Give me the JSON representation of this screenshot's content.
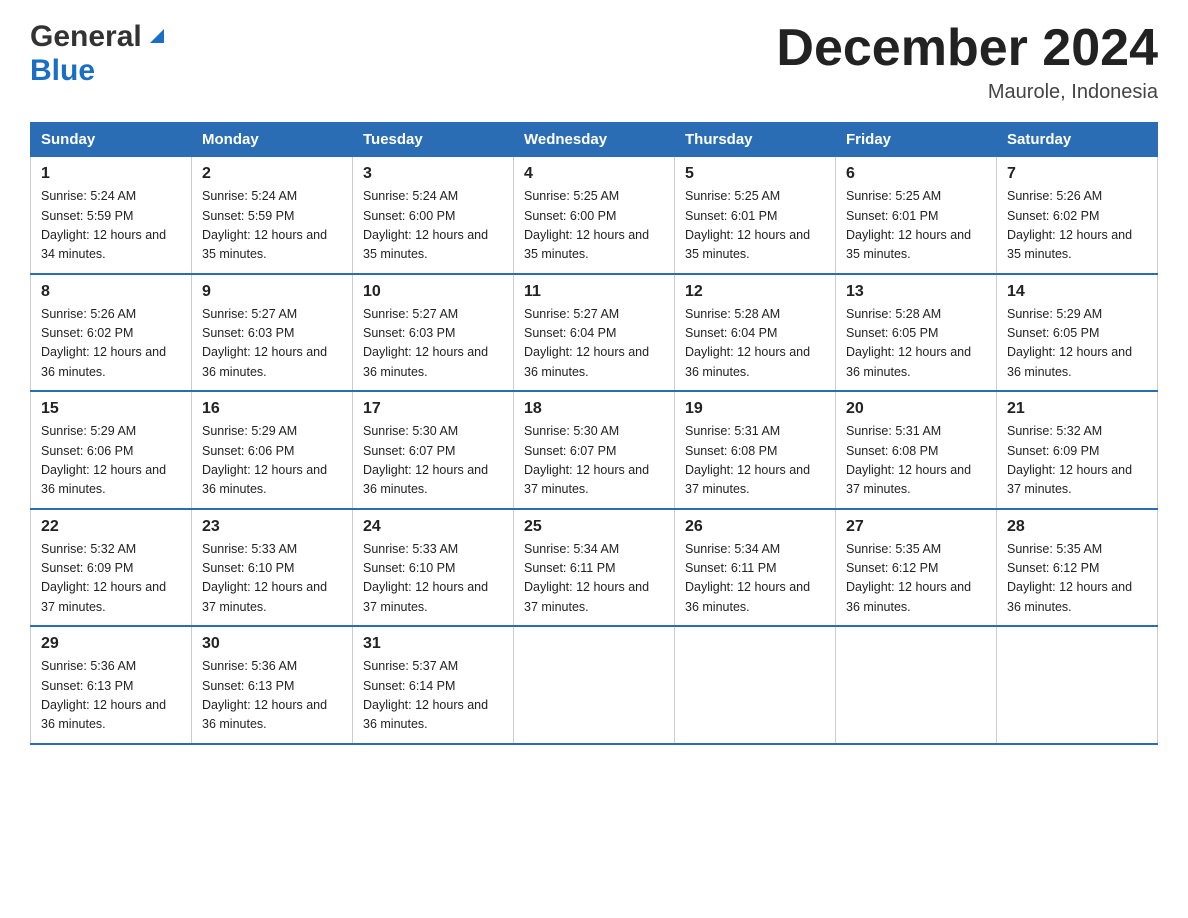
{
  "header": {
    "logo_general": "General",
    "logo_blue": "Blue",
    "month_title": "December 2024",
    "location": "Maurole, Indonesia"
  },
  "days_of_week": [
    "Sunday",
    "Monday",
    "Tuesday",
    "Wednesday",
    "Thursday",
    "Friday",
    "Saturday"
  ],
  "weeks": [
    [
      {
        "day": "1",
        "sunrise": "5:24 AM",
        "sunset": "5:59 PM",
        "daylight": "12 hours and 34 minutes."
      },
      {
        "day": "2",
        "sunrise": "5:24 AM",
        "sunset": "5:59 PM",
        "daylight": "12 hours and 35 minutes."
      },
      {
        "day": "3",
        "sunrise": "5:24 AM",
        "sunset": "6:00 PM",
        "daylight": "12 hours and 35 minutes."
      },
      {
        "day": "4",
        "sunrise": "5:25 AM",
        "sunset": "6:00 PM",
        "daylight": "12 hours and 35 minutes."
      },
      {
        "day": "5",
        "sunrise": "5:25 AM",
        "sunset": "6:01 PM",
        "daylight": "12 hours and 35 minutes."
      },
      {
        "day": "6",
        "sunrise": "5:25 AM",
        "sunset": "6:01 PM",
        "daylight": "12 hours and 35 minutes."
      },
      {
        "day": "7",
        "sunrise": "5:26 AM",
        "sunset": "6:02 PM",
        "daylight": "12 hours and 35 minutes."
      }
    ],
    [
      {
        "day": "8",
        "sunrise": "5:26 AM",
        "sunset": "6:02 PM",
        "daylight": "12 hours and 36 minutes."
      },
      {
        "day": "9",
        "sunrise": "5:27 AM",
        "sunset": "6:03 PM",
        "daylight": "12 hours and 36 minutes."
      },
      {
        "day": "10",
        "sunrise": "5:27 AM",
        "sunset": "6:03 PM",
        "daylight": "12 hours and 36 minutes."
      },
      {
        "day": "11",
        "sunrise": "5:27 AM",
        "sunset": "6:04 PM",
        "daylight": "12 hours and 36 minutes."
      },
      {
        "day": "12",
        "sunrise": "5:28 AM",
        "sunset": "6:04 PM",
        "daylight": "12 hours and 36 minutes."
      },
      {
        "day": "13",
        "sunrise": "5:28 AM",
        "sunset": "6:05 PM",
        "daylight": "12 hours and 36 minutes."
      },
      {
        "day": "14",
        "sunrise": "5:29 AM",
        "sunset": "6:05 PM",
        "daylight": "12 hours and 36 minutes."
      }
    ],
    [
      {
        "day": "15",
        "sunrise": "5:29 AM",
        "sunset": "6:06 PM",
        "daylight": "12 hours and 36 minutes."
      },
      {
        "day": "16",
        "sunrise": "5:29 AM",
        "sunset": "6:06 PM",
        "daylight": "12 hours and 36 minutes."
      },
      {
        "day": "17",
        "sunrise": "5:30 AM",
        "sunset": "6:07 PM",
        "daylight": "12 hours and 36 minutes."
      },
      {
        "day": "18",
        "sunrise": "5:30 AM",
        "sunset": "6:07 PM",
        "daylight": "12 hours and 37 minutes."
      },
      {
        "day": "19",
        "sunrise": "5:31 AM",
        "sunset": "6:08 PM",
        "daylight": "12 hours and 37 minutes."
      },
      {
        "day": "20",
        "sunrise": "5:31 AM",
        "sunset": "6:08 PM",
        "daylight": "12 hours and 37 minutes."
      },
      {
        "day": "21",
        "sunrise": "5:32 AM",
        "sunset": "6:09 PM",
        "daylight": "12 hours and 37 minutes."
      }
    ],
    [
      {
        "day": "22",
        "sunrise": "5:32 AM",
        "sunset": "6:09 PM",
        "daylight": "12 hours and 37 minutes."
      },
      {
        "day": "23",
        "sunrise": "5:33 AM",
        "sunset": "6:10 PM",
        "daylight": "12 hours and 37 minutes."
      },
      {
        "day": "24",
        "sunrise": "5:33 AM",
        "sunset": "6:10 PM",
        "daylight": "12 hours and 37 minutes."
      },
      {
        "day": "25",
        "sunrise": "5:34 AM",
        "sunset": "6:11 PM",
        "daylight": "12 hours and 37 minutes."
      },
      {
        "day": "26",
        "sunrise": "5:34 AM",
        "sunset": "6:11 PM",
        "daylight": "12 hours and 36 minutes."
      },
      {
        "day": "27",
        "sunrise": "5:35 AM",
        "sunset": "6:12 PM",
        "daylight": "12 hours and 36 minutes."
      },
      {
        "day": "28",
        "sunrise": "5:35 AM",
        "sunset": "6:12 PM",
        "daylight": "12 hours and 36 minutes."
      }
    ],
    [
      {
        "day": "29",
        "sunrise": "5:36 AM",
        "sunset": "6:13 PM",
        "daylight": "12 hours and 36 minutes."
      },
      {
        "day": "30",
        "sunrise": "5:36 AM",
        "sunset": "6:13 PM",
        "daylight": "12 hours and 36 minutes."
      },
      {
        "day": "31",
        "sunrise": "5:37 AM",
        "sunset": "6:14 PM",
        "daylight": "12 hours and 36 minutes."
      },
      null,
      null,
      null,
      null
    ]
  ]
}
